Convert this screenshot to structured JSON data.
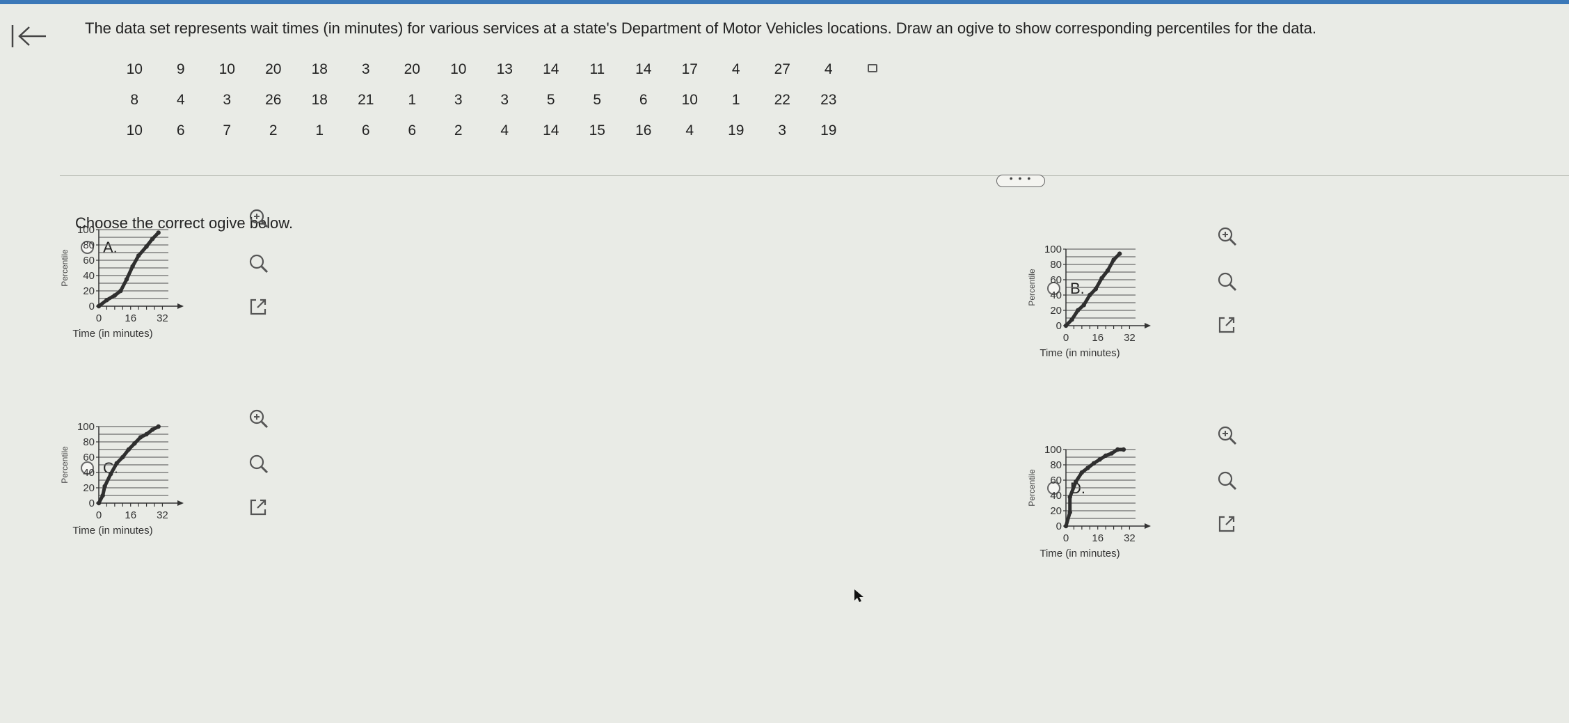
{
  "question": "The data set represents wait times (in minutes) for various services at a state's Department of Motor Vehicles locations. Draw an ogive to show corresponding percentiles for the data.",
  "data_rows": [
    [
      "10",
      "9",
      "10",
      "20",
      "18",
      "3",
      "20",
      "10",
      "13",
      "14",
      "11",
      "14",
      "17",
      "4",
      "27",
      "4"
    ],
    [
      "8",
      "4",
      "3",
      "26",
      "18",
      "21",
      "1",
      "3",
      "3",
      "5",
      "5",
      "6",
      "10",
      "1",
      "22",
      "23"
    ],
    [
      "10",
      "6",
      "7",
      "2",
      "1",
      "6",
      "6",
      "2",
      "4",
      "14",
      "15",
      "16",
      "4",
      "19",
      "3",
      "19"
    ]
  ],
  "more_label": "• • •",
  "prompt": "Choose the correct ogive below.",
  "options": [
    {
      "letter": "A.",
      "chart_data": {
        "type": "line",
        "ylabel": "Percentile",
        "xlabel": "Time (in minutes)",
        "xticks": [
          "0",
          "16",
          "32"
        ],
        "yticks": [
          "0",
          "20",
          "40",
          "60",
          "80",
          "100"
        ],
        "xlim": [
          0,
          35
        ],
        "ylim": [
          0,
          100
        ],
        "x": [
          0,
          4,
          8,
          11,
          14,
          17,
          20,
          24,
          27,
          30
        ],
        "y": [
          0,
          8,
          14,
          20,
          35,
          52,
          66,
          78,
          88,
          96
        ]
      }
    },
    {
      "letter": "B.",
      "chart_data": {
        "type": "line",
        "ylabel": "Percentile",
        "xlabel": "Time (in minutes)",
        "xticks": [
          "0",
          "16",
          "32"
        ],
        "yticks": [
          "0",
          "20",
          "40",
          "60",
          "80",
          "100"
        ],
        "xlim": [
          0,
          35
        ],
        "ylim": [
          0,
          100
        ],
        "x": [
          0,
          3,
          6,
          9,
          12,
          15,
          18,
          21,
          24,
          27
        ],
        "y": [
          0,
          8,
          20,
          27,
          40,
          48,
          62,
          72,
          86,
          94
        ]
      }
    },
    {
      "letter": "C.",
      "chart_data": {
        "type": "line",
        "ylabel": "Percentile",
        "xlabel": "Time (in minutes)",
        "xticks": [
          "0",
          "16",
          "32"
        ],
        "yticks": [
          "0",
          "20",
          "40",
          "60",
          "80",
          "100"
        ],
        "xlim": [
          0,
          35
        ],
        "ylim": [
          0,
          100
        ],
        "x": [
          0,
          2,
          3,
          6,
          9,
          12,
          15,
          18,
          21,
          24,
          27,
          30
        ],
        "y": [
          0,
          10,
          22,
          38,
          52,
          60,
          70,
          78,
          86,
          90,
          96,
          100
        ]
      }
    },
    {
      "letter": "D.",
      "chart_data": {
        "type": "line",
        "ylabel": "Percentile",
        "xlabel": "Time (in minutes)",
        "xticks": [
          "0",
          "16",
          "32"
        ],
        "yticks": [
          "0",
          "20",
          "40",
          "60",
          "80",
          "100"
        ],
        "xlim": [
          0,
          35
        ],
        "ylim": [
          0,
          100
        ],
        "x": [
          0,
          2,
          2,
          5,
          8,
          11,
          14,
          17,
          20,
          23,
          26,
          29
        ],
        "y": [
          0,
          18,
          38,
          58,
          70,
          76,
          82,
          87,
          92,
          95,
          100,
          100
        ]
      }
    }
  ],
  "tool_icons": [
    "zoom-in-icon",
    "zoom-out-icon",
    "open-new-window-icon"
  ],
  "colors": {
    "curve": "#2f2f2f",
    "accent": "#3b78b8",
    "background": "#e9ebe6"
  }
}
